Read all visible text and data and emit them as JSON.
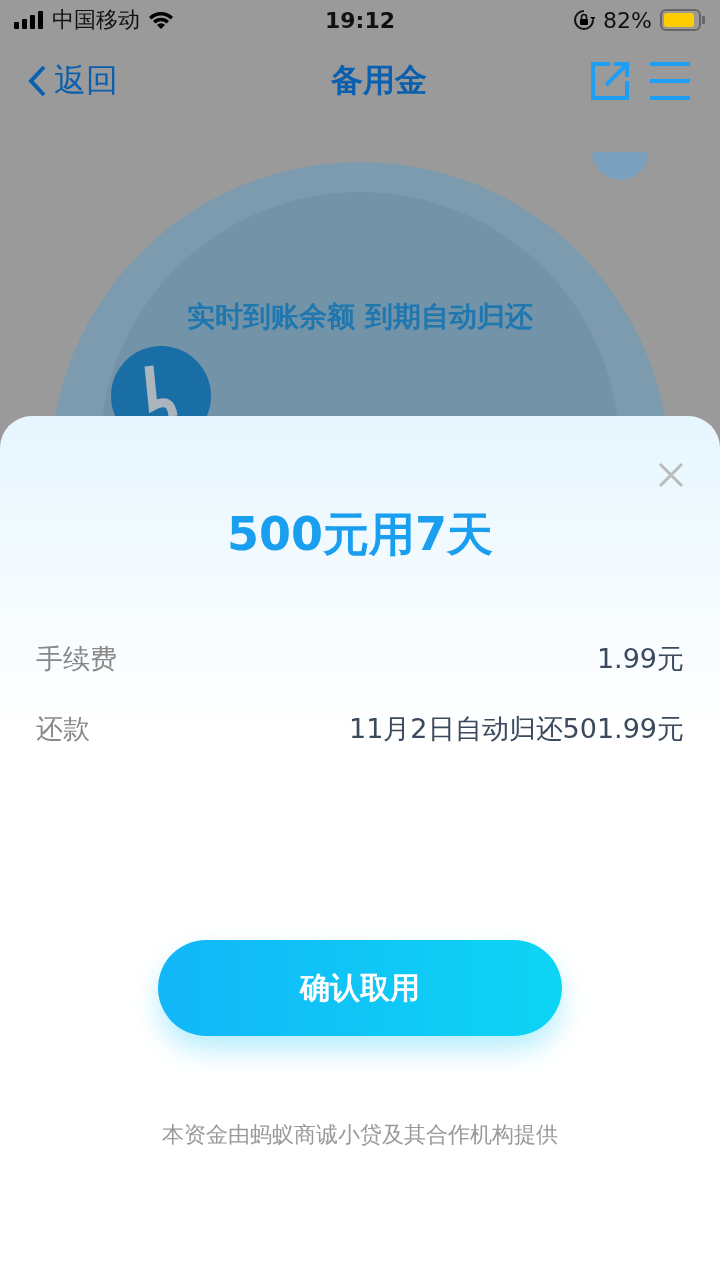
{
  "status_bar": {
    "carrier": "中国移动",
    "time": "19:12",
    "battery": "82%"
  },
  "nav": {
    "back": "返回",
    "title": "备用金"
  },
  "hero": {
    "subtitle": "实时到账余额 到期自动归还"
  },
  "sheet": {
    "title": "500元用7天",
    "rows": [
      {
        "label": "手续费",
        "value": "1.99元"
      },
      {
        "label": "还款",
        "value": "11月2日自动归还501.99元"
      }
    ],
    "confirm": "确认取用",
    "footer": "本资金由蚂蚁商诚小贷及其合作机构提供"
  }
}
